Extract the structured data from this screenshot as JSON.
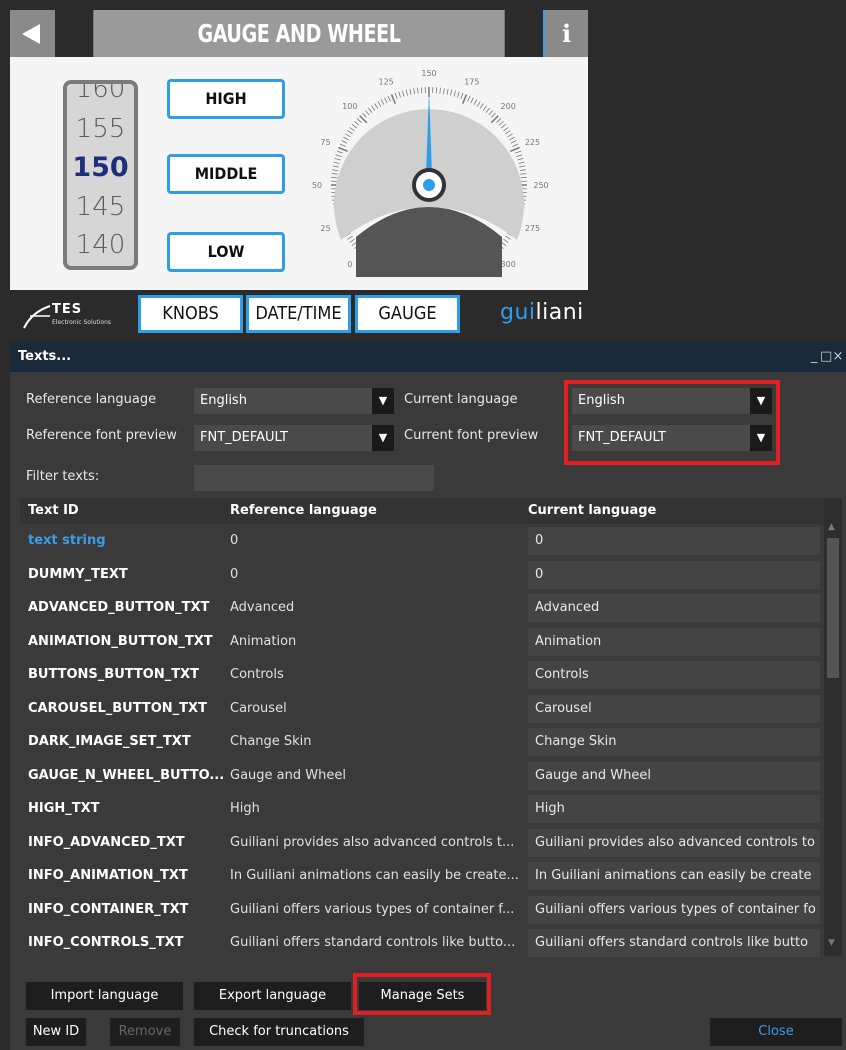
{
  "app": {
    "title": "GAUGE AND WHEEL",
    "info_label": "i",
    "wheel_values": [
      "160",
      "155",
      "150",
      "145",
      "140"
    ],
    "buttons": {
      "high": "HIGH",
      "middle": "MIDDLE",
      "low": "LOW"
    },
    "gauge": {
      "ticks": [
        "0",
        "25",
        "50",
        "75",
        "100",
        "125",
        "150",
        "175",
        "200",
        "225",
        "250",
        "275",
        "300"
      ],
      "value": 150,
      "max": 300
    },
    "logo": {
      "name": "TES",
      "subtitle": "Electronic Solutions"
    },
    "nav": {
      "knobs": "KNOBS",
      "datetime": "DATE/TIME",
      "gauge": "GAUGE"
    },
    "brand": {
      "part1": "gui",
      "part2": "liani"
    }
  },
  "window": {
    "title": "Texts...",
    "controls": [
      "_",
      "□",
      "×"
    ],
    "reference_language_label": "Reference language",
    "reference_language_value": "English",
    "current_language_label": "Current language",
    "current_language_value": "English",
    "reference_font_label": "Reference font preview",
    "reference_font_value": "FNT_DEFAULT",
    "current_font_label": "Current font preview",
    "current_font_value": "FNT_DEFAULT",
    "filter_label": "Filter texts:",
    "filter_value": "",
    "columns": [
      "Text ID",
      "Reference language",
      "Current language"
    ],
    "rows": [
      {
        "id": "text string",
        "ref": "0",
        "cur": "0"
      },
      {
        "id": "DUMMY_TEXT",
        "ref": "0",
        "cur": "0"
      },
      {
        "id": "ADVANCED_BUTTON_TXT",
        "ref": "Advanced",
        "cur": "Advanced"
      },
      {
        "id": "ANIMATION_BUTTON_TXT",
        "ref": "Animation",
        "cur": "Animation"
      },
      {
        "id": "BUTTONS_BUTTON_TXT",
        "ref": "Controls",
        "cur": "Controls"
      },
      {
        "id": "CAROUSEL_BUTTON_TXT",
        "ref": "Carousel",
        "cur": "Carousel"
      },
      {
        "id": "DARK_IMAGE_SET_TXT",
        "ref": "Change Skin",
        "cur": "Change Skin"
      },
      {
        "id": "GAUGE_N_WHEEL_BUTTO...",
        "ref": "Gauge and Wheel",
        "cur": "Gauge and Wheel"
      },
      {
        "id": "HIGH_TXT",
        "ref": "High",
        "cur": "High"
      },
      {
        "id": "INFO_ADVANCED_TXT",
        "ref": "Guiliani provides also advanced controls t...",
        "cur": "Guiliani provides also advanced controls to"
      },
      {
        "id": "INFO_ANIMATION_TXT",
        "ref": "In Guiliani animations can easily be create...",
        "cur": "In Guiliani animations can easily be create"
      },
      {
        "id": "INFO_CONTAINER_TXT",
        "ref": "Guiliani offers various types of container f...",
        "cur": "Guiliani offers various types of container fo"
      },
      {
        "id": "INFO_CONTROLS_TXT",
        "ref": "Guiliani offers standard controls like butto...",
        "cur": "Guiliani offers standard controls like butto"
      }
    ],
    "buttons": {
      "import": "Import language",
      "export": "Export language",
      "manage_sets": "Manage Sets",
      "new_id": "New ID",
      "remove": "Remove",
      "check_truncations": "Check for truncations",
      "close": "Close"
    }
  },
  "colors": {
    "accent": "#2f9ee8",
    "highlight": "#e02020",
    "title_bar": "#1b2a38"
  }
}
